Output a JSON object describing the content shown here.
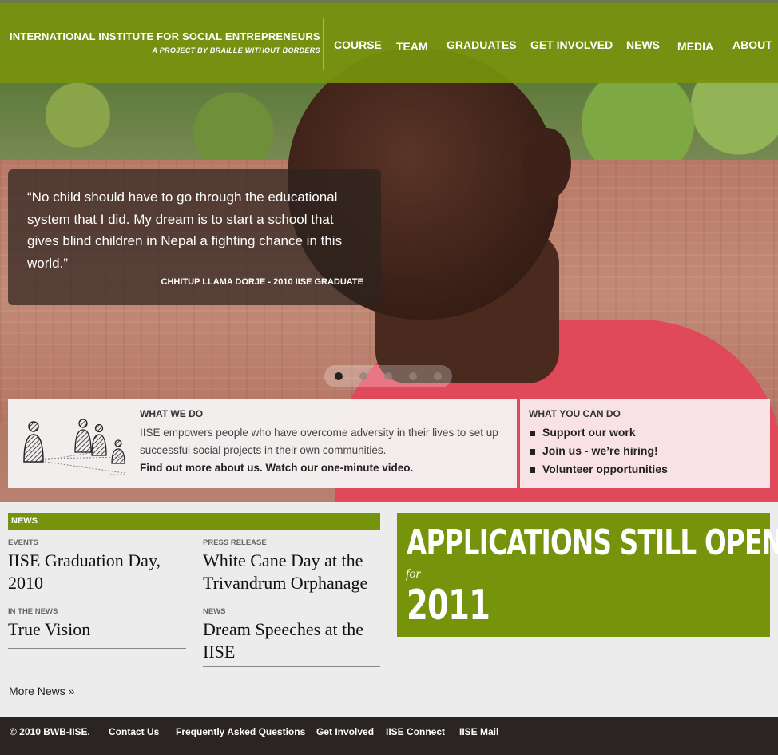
{
  "header": {
    "brand_title": "INTERNATIONAL INSTITUTE FOR SOCIAL ENTREPRENEURS",
    "brand_subtitle": "A PROJECT BY BRAILLE WITHOUT BORDERS",
    "nav": [
      "COURSE",
      "TEAM",
      "GRADUATES",
      "GET INVOLVED",
      "NEWS",
      "MEDIA",
      "ABOUT"
    ]
  },
  "hero": {
    "quote": "“No child should have to go through the educational system that I did. My dream is to start a school that gives blind children in Nepal a fighting chance in this world.”",
    "attribution": "CHHITUP LLAMA DORJE - 2010 IISE GRADUATE",
    "slides_total": 5,
    "slide_active": 1
  },
  "what_we_do": {
    "label": "WHAT WE DO",
    "body": "IISE empowers people who have overcome adversity in their lives to set up successful social projects in their own communities.",
    "link": "Find out more about us. Watch our one-minute video."
  },
  "what_you_can_do": {
    "label": "WHAT YOU CAN DO",
    "items": [
      "Support our work",
      "Join us - we’re hiring!",
      "Volunteer opportunities"
    ]
  },
  "news": {
    "header": "NEWS",
    "items": [
      {
        "category": "EVENTS",
        "title": "IISE Graduation Day, 2010"
      },
      {
        "category": "PRESS RELEASE",
        "title": "White Cane Day at the Trivandrum Orphanage"
      },
      {
        "category": "IN THE NEWS",
        "title": "True Vision"
      },
      {
        "category": "NEWS",
        "title": "Dream Speeches at the IISE"
      }
    ],
    "more": "More News »"
  },
  "applications": {
    "line1": "APPLICATIONS STILL OPEN",
    "for": "for",
    "year": "2011"
  },
  "footer": {
    "copyright": "© 2010 BWB-IISE.",
    "links": [
      "Contact Us",
      "Frequently Asked Questions",
      "Get Involved",
      "IISE Connect",
      "IISE Mail"
    ]
  },
  "colors": {
    "brand_green": "#76930c",
    "footer_bg": "#2a2422",
    "page_bg": "#ececec"
  }
}
